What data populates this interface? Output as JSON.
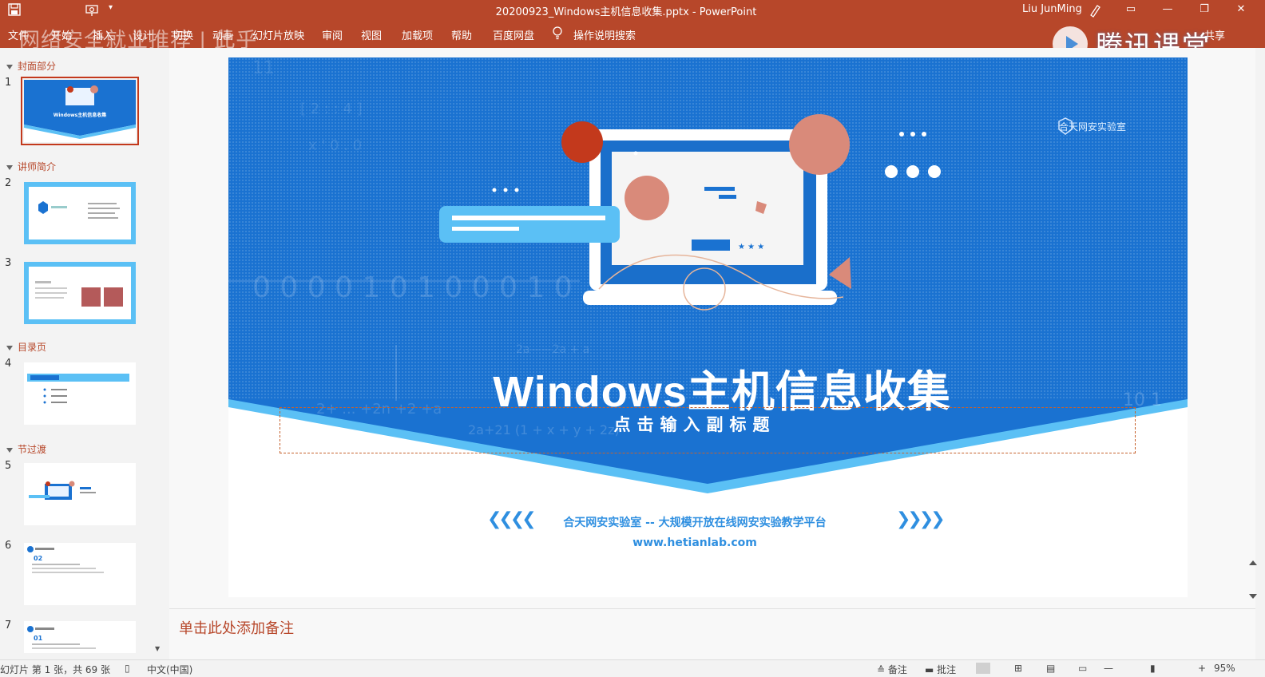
{
  "window": {
    "document_title": "20200923_Windows主机信息收集.pptx  -  PowerPoint",
    "user_name": "Liu JunMing"
  },
  "ribbon": {
    "tabs": [
      "文件",
      "开始",
      "插入",
      "设计",
      "切换",
      "动画",
      "幻灯片放映",
      "审阅",
      "视图",
      "加载项",
      "帮助",
      "百度网盘"
    ],
    "search_label": "操作说明搜索",
    "share_label": "共享"
  },
  "overlay": {
    "title": "网络安全就业推荐 | 此乎",
    "brand": "腾讯课堂"
  },
  "thumbnails": {
    "sections": [
      {
        "name": "封面部分"
      },
      {
        "name": "讲师简介"
      },
      {
        "name": "目录页"
      },
      {
        "name": "节过渡"
      }
    ],
    "slides": [
      "1",
      "2",
      "3",
      "4",
      "5",
      "6",
      "7"
    ],
    "selected": 1
  },
  "slide": {
    "title": "Windows主机信息收集",
    "subtitle": "点击输入副标题",
    "lab_name": "合天网安实验室",
    "tagline": "合天网安实验室 -- 大规模开放在线网安实验教学平台",
    "url": "www.hetianlab.com",
    "chevron_left": "❮❮❮❮",
    "chevron_right": "❯❯❯❯"
  },
  "notes": {
    "placeholder": "单击此处添加备注"
  },
  "status": {
    "slide_info": "幻灯片 第 1 张，共 69 张",
    "language": "中文(中国)",
    "notes_label": "备注",
    "comments_label": "批注",
    "zoom": "95%"
  },
  "colors": {
    "ribbon": "#b7472a",
    "slide_blue": "#1a72d1",
    "light_blue": "#5bc0f5",
    "accent_red": "#c3391c"
  }
}
